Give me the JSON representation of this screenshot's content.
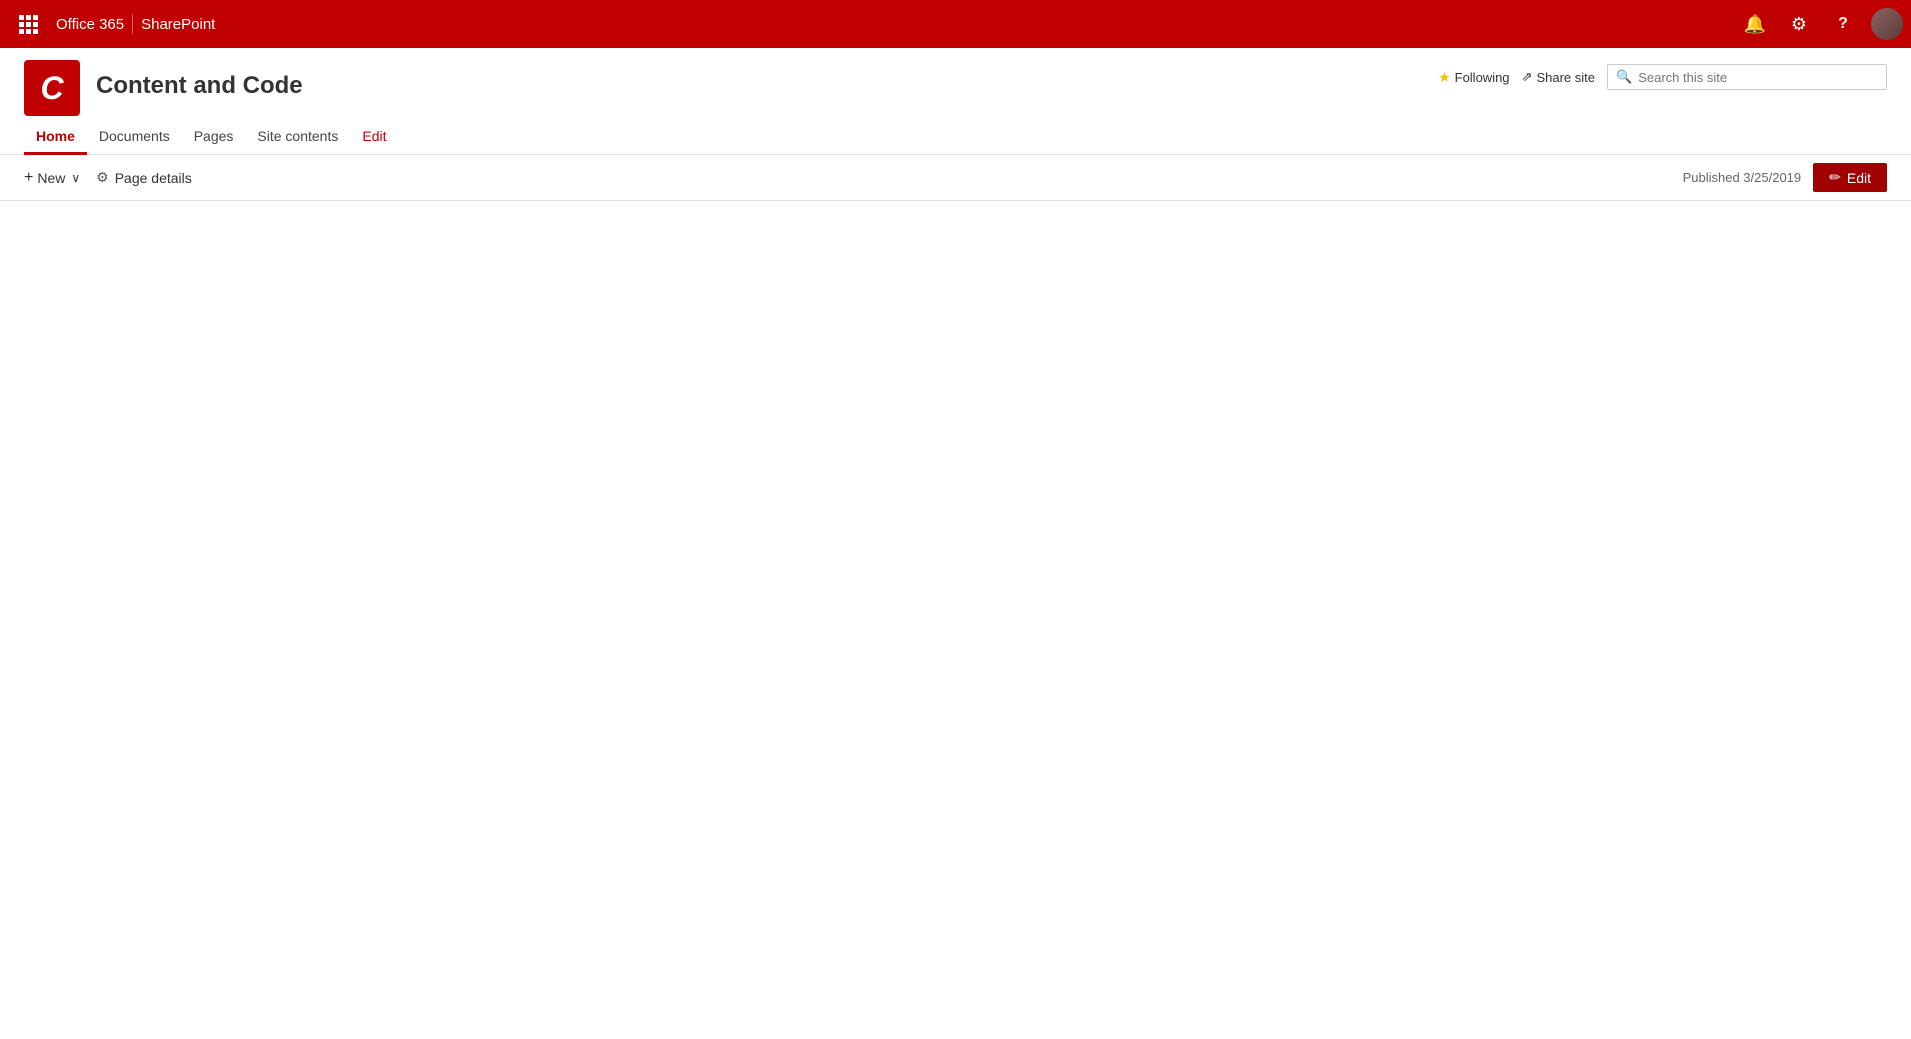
{
  "topbar": {
    "office_label": "Office 365",
    "sharepoint_label": "SharePoint"
  },
  "site_header": {
    "logo_letter": "C",
    "site_title": "Content and Code",
    "following_label": "Following",
    "share_label": "Share site",
    "search_placeholder": "Search this site"
  },
  "navigation": {
    "items": [
      {
        "label": "Home",
        "active": true
      },
      {
        "label": "Documents",
        "active": false
      },
      {
        "label": "Pages",
        "active": false
      },
      {
        "label": "Site contents",
        "active": false
      },
      {
        "label": "Edit",
        "active": false,
        "is_edit": true
      }
    ]
  },
  "toolbar": {
    "new_label": "New",
    "page_details_label": "Page details",
    "published_text": "Published 3/25/2019",
    "edit_button_label": "Edit"
  },
  "icons": {
    "bell": "🔔",
    "gear": "⚙",
    "help": "?",
    "star": "★",
    "share": "↗",
    "search": "🔍",
    "pencil": "✏",
    "plus": "+",
    "gear_small": "⚙",
    "chevron_down": "⌄"
  }
}
